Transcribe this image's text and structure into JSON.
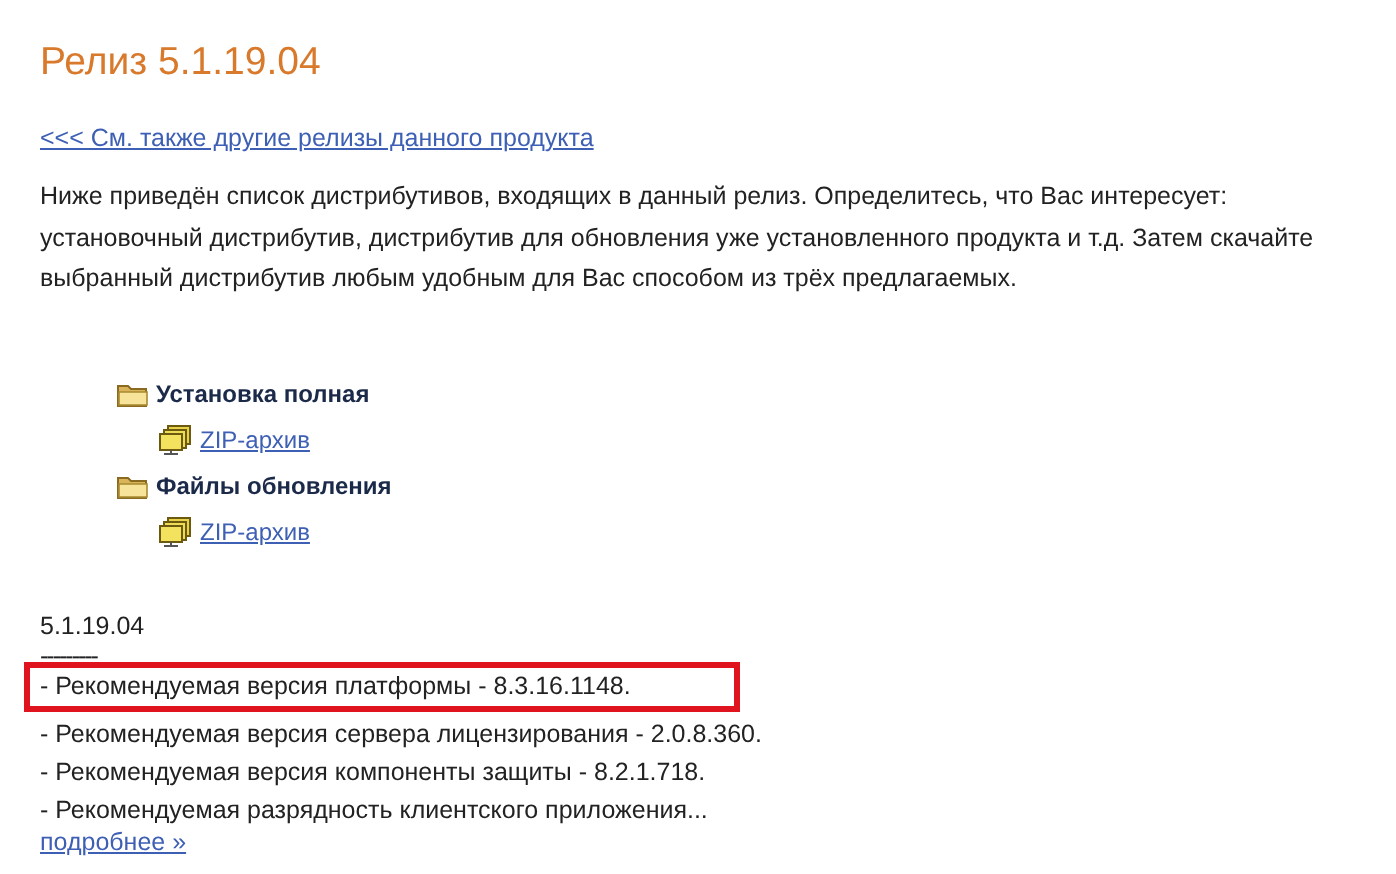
{
  "title": "Релиз 5.1.19.04",
  "back_link": "<<< См. также другие релизы данного продукта",
  "intro": "Ниже приведён список дистрибутивов, входящих в данный релиз. Определитесь, что Вас интересует: установочный дистрибутив, дистрибутив для обновления уже установленного продукта и т.д. Затем скачайте выбранный дистрибутив любым удобным для Вас способом из трёх предлагаемых.",
  "distributions": [
    {
      "label": "Установка полная",
      "children": [
        {
          "label": "ZIP-архив"
        }
      ]
    },
    {
      "label": "Файлы обновления",
      "children": [
        {
          "label": "ZIP-архив"
        }
      ]
    }
  ],
  "notes": {
    "version": "5.1.19.04",
    "separator": "---------",
    "lines": [
      {
        "text": "- Рекомендуемая версия платформы - 8.3.16.1148.",
        "highlighted": true
      },
      {
        "text": "- Рекомендуемая версия сервера лицензирования - 2.0.8.360.",
        "highlighted": false
      },
      {
        "text": "- Рекомендуемая версия компоненты защиты - 8.2.1.718.",
        "highlighted": false
      },
      {
        "text": "- Рекомендуемая разрядность клиентского приложения...",
        "highlighted": false
      }
    ],
    "more_link": "подробнее »"
  }
}
